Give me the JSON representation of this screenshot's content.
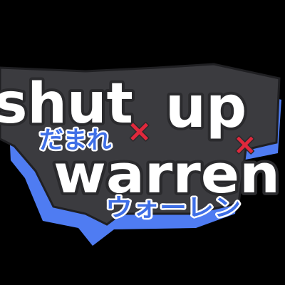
{
  "logo": {
    "line1_left": "shut",
    "line1_right": "up",
    "line2": "warren",
    "jp_top": "だまれ",
    "jp_bottom": "ウォーレン",
    "cross_mark": "×"
  },
  "colors": {
    "background": "#000000",
    "plate_dark": "#3b3b3f",
    "outline_white": "#ffffff",
    "accent_blue": "#4f7cf2",
    "text_blue": "#3f6fe6",
    "cross_red": "#e0283c"
  }
}
